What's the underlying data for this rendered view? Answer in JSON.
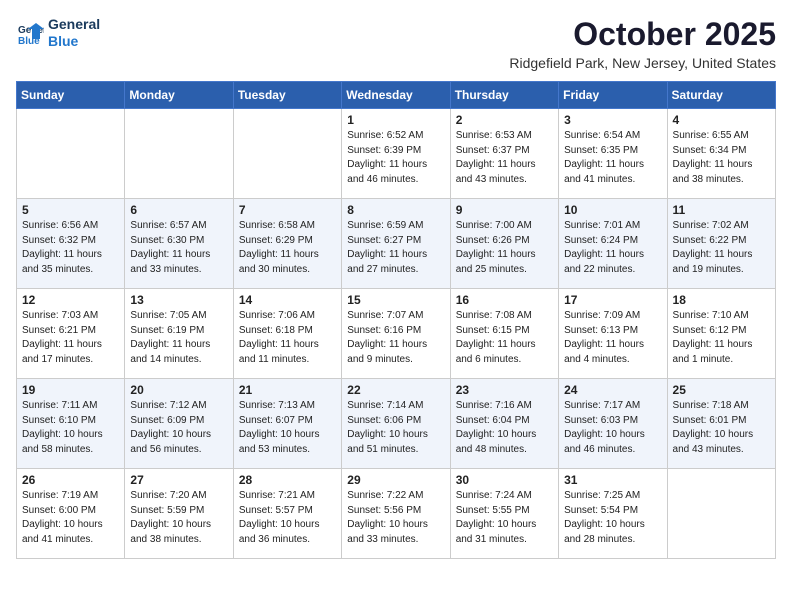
{
  "header": {
    "logo_line1": "General",
    "logo_line2": "Blue",
    "month": "October 2025",
    "location": "Ridgefield Park, New Jersey, United States"
  },
  "weekdays": [
    "Sunday",
    "Monday",
    "Tuesday",
    "Wednesday",
    "Thursday",
    "Friday",
    "Saturday"
  ],
  "weeks": [
    [
      {
        "day": "",
        "info": ""
      },
      {
        "day": "",
        "info": ""
      },
      {
        "day": "",
        "info": ""
      },
      {
        "day": "1",
        "info": "Sunrise: 6:52 AM\nSunset: 6:39 PM\nDaylight: 11 hours\nand 46 minutes."
      },
      {
        "day": "2",
        "info": "Sunrise: 6:53 AM\nSunset: 6:37 PM\nDaylight: 11 hours\nand 43 minutes."
      },
      {
        "day": "3",
        "info": "Sunrise: 6:54 AM\nSunset: 6:35 PM\nDaylight: 11 hours\nand 41 minutes."
      },
      {
        "day": "4",
        "info": "Sunrise: 6:55 AM\nSunset: 6:34 PM\nDaylight: 11 hours\nand 38 minutes."
      }
    ],
    [
      {
        "day": "5",
        "info": "Sunrise: 6:56 AM\nSunset: 6:32 PM\nDaylight: 11 hours\nand 35 minutes."
      },
      {
        "day": "6",
        "info": "Sunrise: 6:57 AM\nSunset: 6:30 PM\nDaylight: 11 hours\nand 33 minutes."
      },
      {
        "day": "7",
        "info": "Sunrise: 6:58 AM\nSunset: 6:29 PM\nDaylight: 11 hours\nand 30 minutes."
      },
      {
        "day": "8",
        "info": "Sunrise: 6:59 AM\nSunset: 6:27 PM\nDaylight: 11 hours\nand 27 minutes."
      },
      {
        "day": "9",
        "info": "Sunrise: 7:00 AM\nSunset: 6:26 PM\nDaylight: 11 hours\nand 25 minutes."
      },
      {
        "day": "10",
        "info": "Sunrise: 7:01 AM\nSunset: 6:24 PM\nDaylight: 11 hours\nand 22 minutes."
      },
      {
        "day": "11",
        "info": "Sunrise: 7:02 AM\nSunset: 6:22 PM\nDaylight: 11 hours\nand 19 minutes."
      }
    ],
    [
      {
        "day": "12",
        "info": "Sunrise: 7:03 AM\nSunset: 6:21 PM\nDaylight: 11 hours\nand 17 minutes."
      },
      {
        "day": "13",
        "info": "Sunrise: 7:05 AM\nSunset: 6:19 PM\nDaylight: 11 hours\nand 14 minutes."
      },
      {
        "day": "14",
        "info": "Sunrise: 7:06 AM\nSunset: 6:18 PM\nDaylight: 11 hours\nand 11 minutes."
      },
      {
        "day": "15",
        "info": "Sunrise: 7:07 AM\nSunset: 6:16 PM\nDaylight: 11 hours\nand 9 minutes."
      },
      {
        "day": "16",
        "info": "Sunrise: 7:08 AM\nSunset: 6:15 PM\nDaylight: 11 hours\nand 6 minutes."
      },
      {
        "day": "17",
        "info": "Sunrise: 7:09 AM\nSunset: 6:13 PM\nDaylight: 11 hours\nand 4 minutes."
      },
      {
        "day": "18",
        "info": "Sunrise: 7:10 AM\nSunset: 6:12 PM\nDaylight: 11 hours\nand 1 minute."
      }
    ],
    [
      {
        "day": "19",
        "info": "Sunrise: 7:11 AM\nSunset: 6:10 PM\nDaylight: 10 hours\nand 58 minutes."
      },
      {
        "day": "20",
        "info": "Sunrise: 7:12 AM\nSunset: 6:09 PM\nDaylight: 10 hours\nand 56 minutes."
      },
      {
        "day": "21",
        "info": "Sunrise: 7:13 AM\nSunset: 6:07 PM\nDaylight: 10 hours\nand 53 minutes."
      },
      {
        "day": "22",
        "info": "Sunrise: 7:14 AM\nSunset: 6:06 PM\nDaylight: 10 hours\nand 51 minutes."
      },
      {
        "day": "23",
        "info": "Sunrise: 7:16 AM\nSunset: 6:04 PM\nDaylight: 10 hours\nand 48 minutes."
      },
      {
        "day": "24",
        "info": "Sunrise: 7:17 AM\nSunset: 6:03 PM\nDaylight: 10 hours\nand 46 minutes."
      },
      {
        "day": "25",
        "info": "Sunrise: 7:18 AM\nSunset: 6:01 PM\nDaylight: 10 hours\nand 43 minutes."
      }
    ],
    [
      {
        "day": "26",
        "info": "Sunrise: 7:19 AM\nSunset: 6:00 PM\nDaylight: 10 hours\nand 41 minutes."
      },
      {
        "day": "27",
        "info": "Sunrise: 7:20 AM\nSunset: 5:59 PM\nDaylight: 10 hours\nand 38 minutes."
      },
      {
        "day": "28",
        "info": "Sunrise: 7:21 AM\nSunset: 5:57 PM\nDaylight: 10 hours\nand 36 minutes."
      },
      {
        "day": "29",
        "info": "Sunrise: 7:22 AM\nSunset: 5:56 PM\nDaylight: 10 hours\nand 33 minutes."
      },
      {
        "day": "30",
        "info": "Sunrise: 7:24 AM\nSunset: 5:55 PM\nDaylight: 10 hours\nand 31 minutes."
      },
      {
        "day": "31",
        "info": "Sunrise: 7:25 AM\nSunset: 5:54 PM\nDaylight: 10 hours\nand 28 minutes."
      },
      {
        "day": "",
        "info": ""
      }
    ]
  ]
}
